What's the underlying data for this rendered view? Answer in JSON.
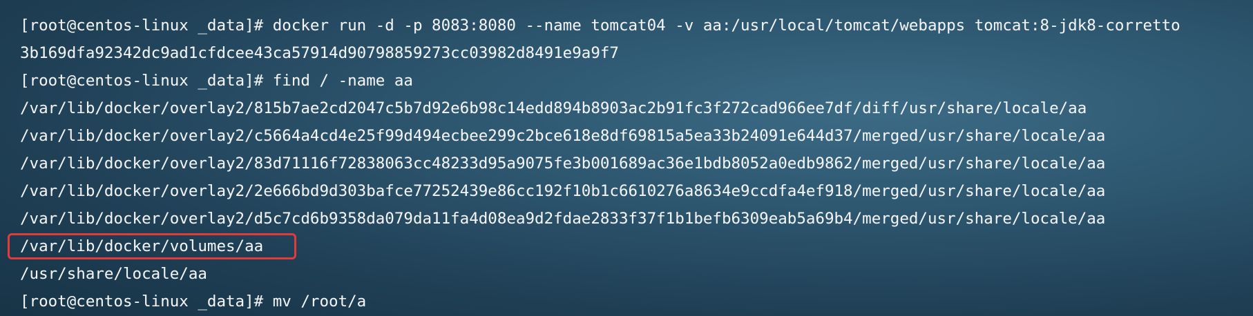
{
  "terminal": {
    "lines": [
      "[root@centos-linux _data]# docker run -d -p 8083:8080 --name tomcat04 -v aa:/usr/local/tomcat/webapps tomcat:8-jdk8-corretto",
      "3b169dfa92342dc9ad1cfdcee43ca57914d90798859273cc03982d8491e9a9f7",
      "[root@centos-linux _data]# find / -name aa",
      "/var/lib/docker/overlay2/815b7ae2cd2047c5b7d92e6b98c14edd894b8903ac2b91fc3f272cad966ee7df/diff/usr/share/locale/aa",
      "/var/lib/docker/overlay2/c5664a4cd4e25f99d494ecbee299c2bce618e8df69815a5ea33b24091e644d37/merged/usr/share/locale/aa",
      "/var/lib/docker/overlay2/83d71116f72838063cc48233d95a9075fe3b001689ac36e1bdb8052a0edb9862/merged/usr/share/locale/aa",
      "/var/lib/docker/overlay2/2e666bd9d303bafce77252439e86cc192f10b1c6610276a8634e9ccdfa4ef918/merged/usr/share/locale/aa",
      "/var/lib/docker/overlay2/d5c7cd6b9358da079da11fa4d08ea9d2fdae2833f37f1b1befb6309eab5a69b4/merged/usr/share/locale/aa",
      "/var/lib/docker/volumes/aa",
      "/usr/share/locale/aa",
      "[root@centos-linux _data]# mv /root/a"
    ]
  },
  "colors": {
    "text": "#f2f4f6",
    "highlight_border": "#e23b3b",
    "background": "#2d566f"
  }
}
